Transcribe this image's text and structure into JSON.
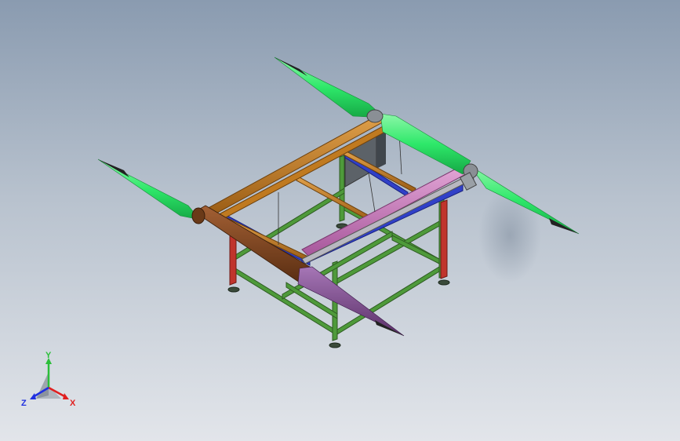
{
  "view": {
    "background_top": "#8a9bb0",
    "background_bottom": "#e2e5ea"
  },
  "model": {
    "part_colors": {
      "frame_legs": "#4e9a3a",
      "red_legs": "#c0342c",
      "orange_rails": "#c07a20",
      "pink_rail": "#c773b8",
      "blue_rails": "#3040c8",
      "brown_roller": "#7a4420",
      "purple_spindle": "#7a4a8a",
      "green_spindles": "#2ee86a",
      "spindle_tips": "#222222"
    }
  },
  "triad": {
    "y_label": "Y",
    "x_label": "X",
    "z_label": "Z",
    "y_color": "#2bbf3a",
    "x_color": "#e02020",
    "z_color": "#2030e0"
  }
}
